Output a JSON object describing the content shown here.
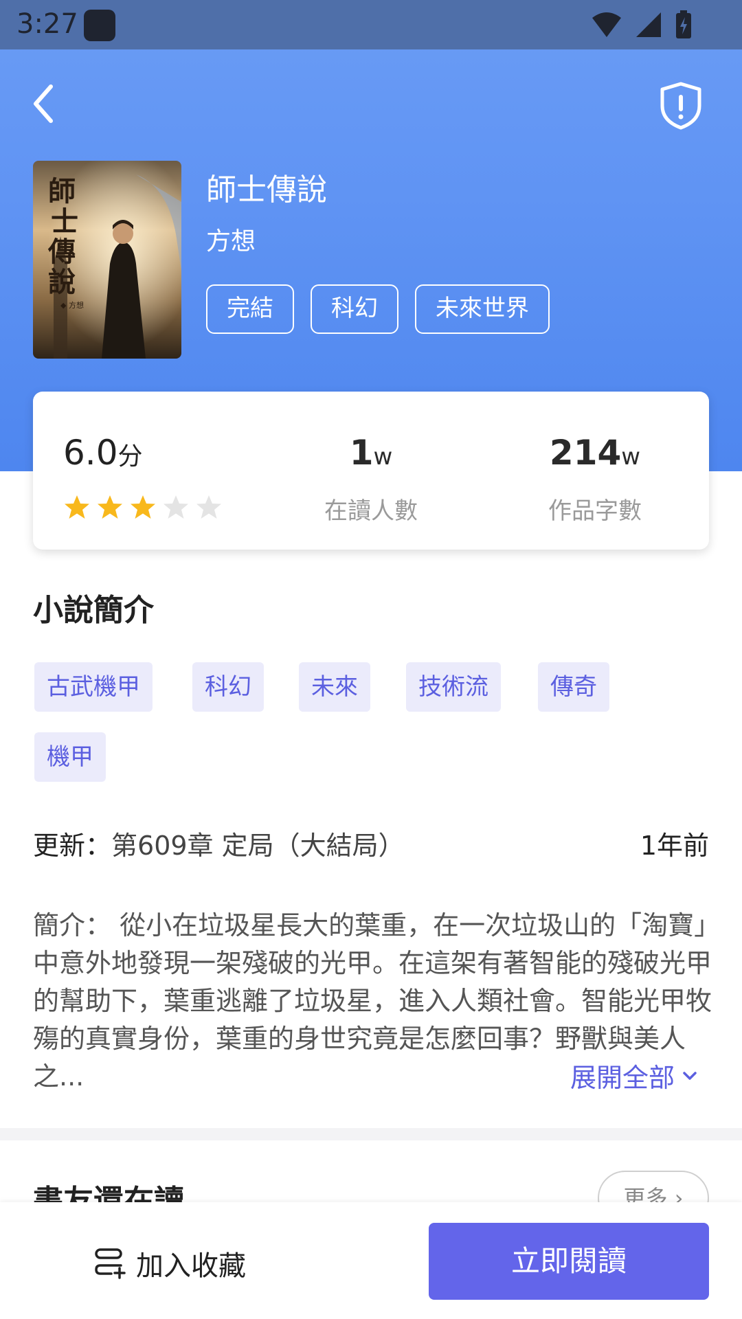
{
  "status_bar": {
    "time": "3:27"
  },
  "book": {
    "title": "師士傳說",
    "author": "方想",
    "tags": [
      "完結",
      "科幻",
      "未來世界"
    ],
    "cover_title": "師士傳說",
    "cover_author": "方想"
  },
  "stats": {
    "score": "6.0",
    "score_unit": "分",
    "rating_stars": 3,
    "rating_max": 5,
    "readers_value": "1",
    "readers_unit": "w",
    "readers_label": "在讀人數",
    "words_value": "214",
    "words_unit": "w",
    "words_label": "作品字數"
  },
  "intro": {
    "title": "小說簡介",
    "keywords": [
      "古武機甲",
      "科幻",
      "未來",
      "技術流",
      "傳奇",
      "機甲"
    ],
    "update_label": "更新：",
    "update_chapter": "第609章 定局（大結局）",
    "update_time": "1年前",
    "synopsis": "簡介： 從小在垃圾星長大的葉重，在一次垃圾山的「淘寶」中意外地發現一架殘破的光甲。在這架有著智能的殘破光甲的幫助下，葉重逃離了垃圾星，進入人類社會。智能光甲牧殤的真實身份，葉重的身世究竟是怎麼回事？野獸與美人之...",
    "expand_label": "展開全部"
  },
  "also_reading": {
    "title": "書友還在讀",
    "more_label": "更多"
  },
  "actions": {
    "favorite_label": "加入收藏",
    "read_label": "立即閱讀"
  },
  "colors": {
    "accent": "#6365ea",
    "header_gradient_top": "#6a9cf5",
    "header_gradient_bottom": "#4e86ef",
    "star_filled": "#f8b81c",
    "star_empty": "#e4e4e4",
    "chip_bg": "#ebebfb"
  },
  "icons": {
    "back": "chevron-left-icon",
    "report": "shield-alert-icon",
    "expand": "chevron-down-icon",
    "more": "chevron-right-icon",
    "favorite": "bookshelf-add-icon"
  }
}
